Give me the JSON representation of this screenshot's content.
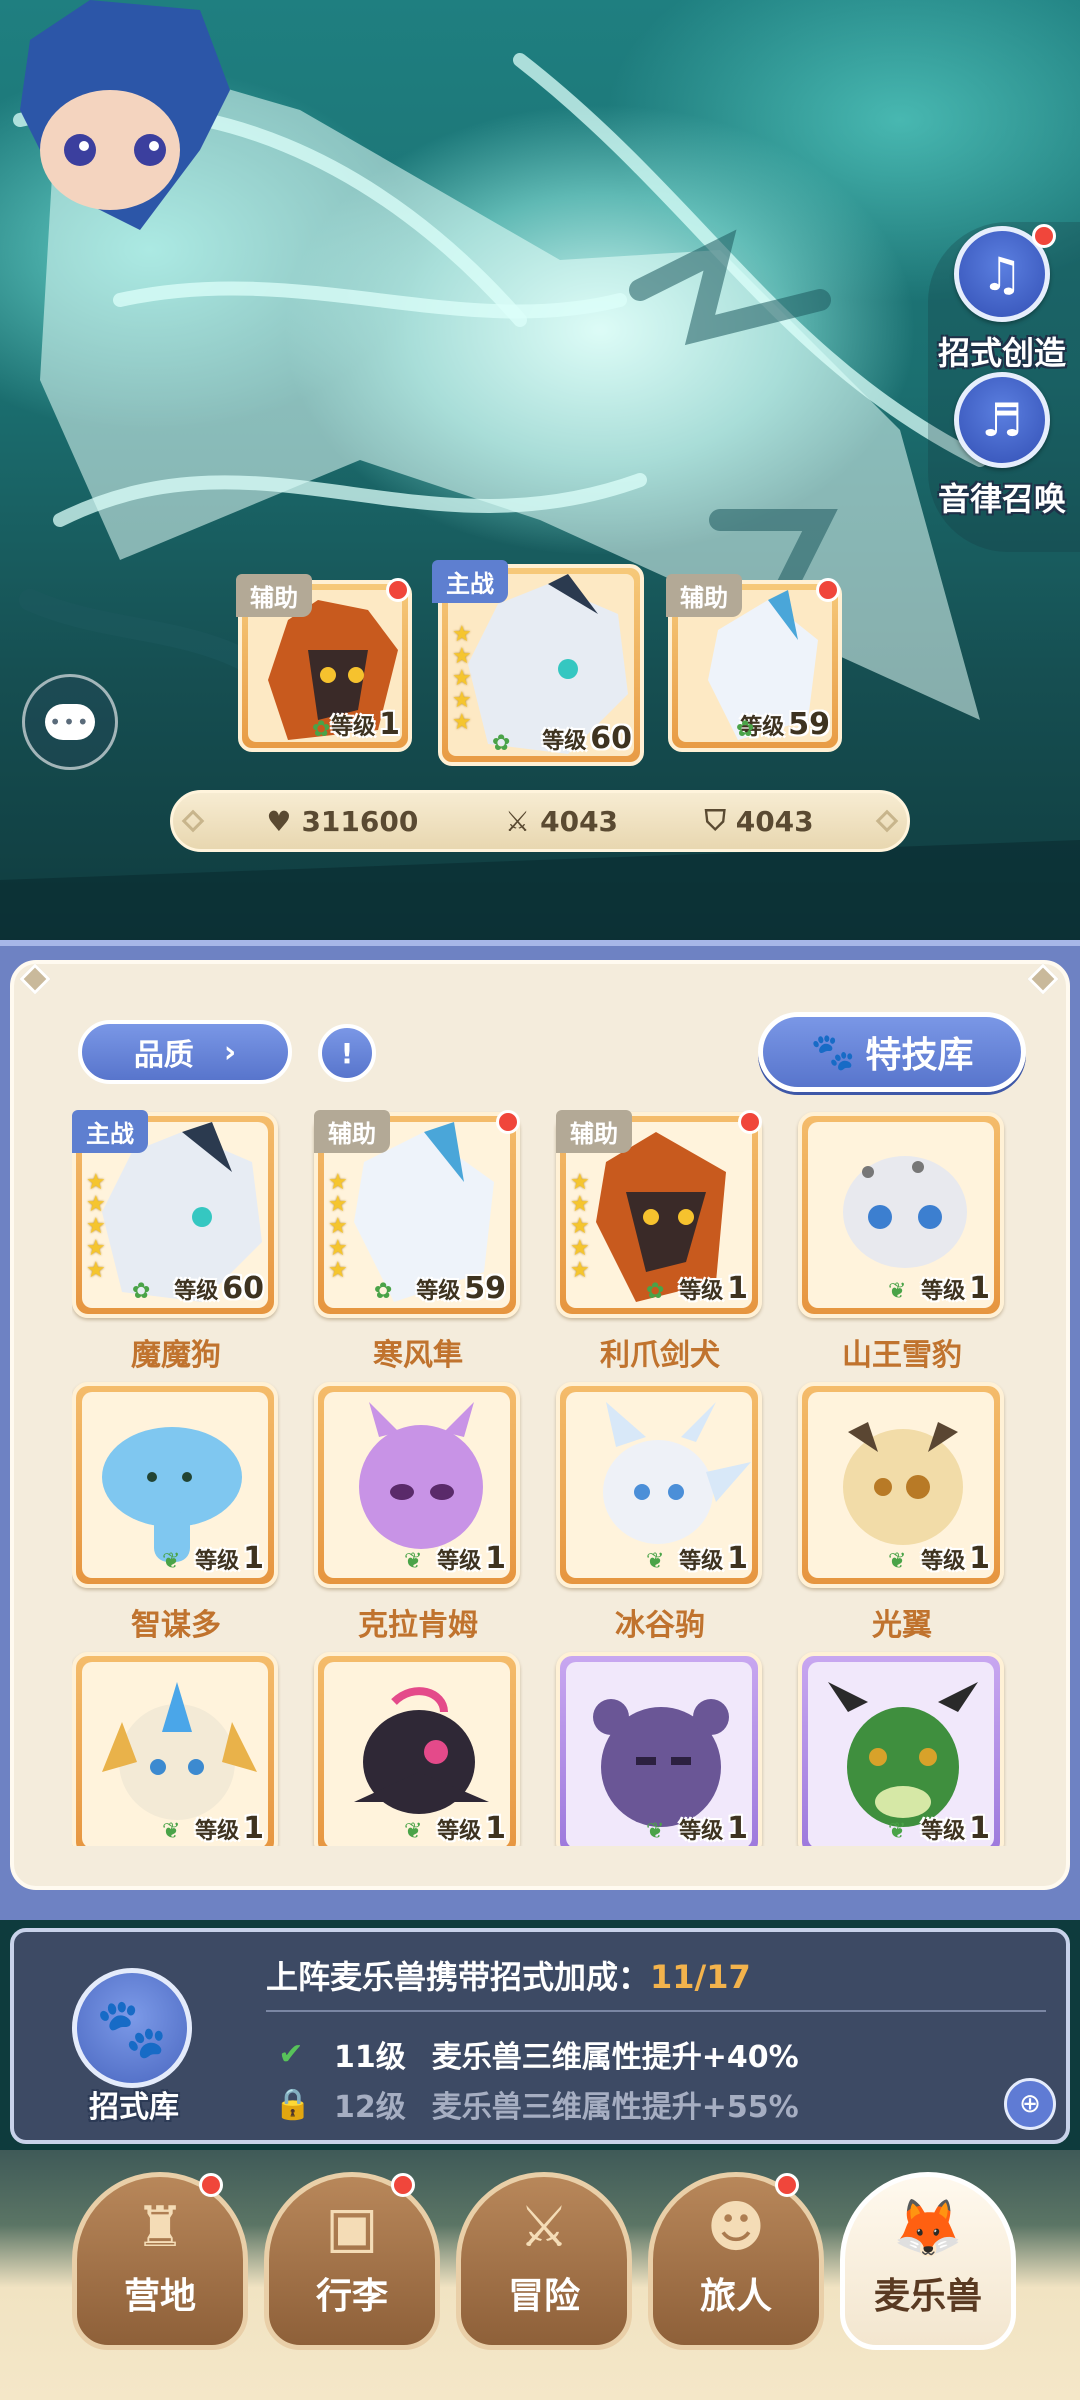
{
  "side_buttons": [
    {
      "label": "招式创造",
      "icon": "music-book-icon",
      "has_dot": true
    },
    {
      "label": "音律召唤",
      "icon": "lyre-icon",
      "has_dot": false
    }
  ],
  "team": [
    {
      "role": "辅助",
      "level_label": "等级",
      "level": "1",
      "has_dot": true
    },
    {
      "role": "主战",
      "level_label": "等级",
      "level": "60",
      "has_dot": false
    },
    {
      "role": "辅助",
      "level_label": "等级",
      "level": "59",
      "has_dot": true
    }
  ],
  "stats": {
    "hp": "311600",
    "attack": "4043",
    "defense": "4043"
  },
  "filters": {
    "quality_label": "品质",
    "book_label": "!",
    "skill_library_label": "特技库"
  },
  "pets": [
    {
      "name": "魔魔狗",
      "role": "主战",
      "level_label": "等级",
      "level": "60",
      "color": "orange",
      "stars": 5
    },
    {
      "name": "寒风隼",
      "role": "辅助",
      "level_label": "等级",
      "level": "59",
      "color": "orange",
      "stars": 5
    },
    {
      "name": "利爪剑犬",
      "role": "辅助",
      "level_label": "等级",
      "level": "1",
      "color": "orange",
      "stars": 5
    },
    {
      "name": "山王雪豹",
      "role": "",
      "level_label": "等级",
      "level": "1",
      "color": "orange",
      "stars": 0
    },
    {
      "name": "智谋多",
      "role": "",
      "level_label": "等级",
      "level": "1",
      "color": "orange",
      "stars": 0
    },
    {
      "name": "克拉肯姆",
      "role": "",
      "level_label": "等级",
      "level": "1",
      "color": "orange",
      "stars": 0
    },
    {
      "name": "冰谷驹",
      "role": "",
      "level_label": "等级",
      "level": "1",
      "color": "orange",
      "stars": 0
    },
    {
      "name": "光翼",
      "role": "",
      "level_label": "等级",
      "level": "1",
      "color": "orange",
      "stars": 0
    },
    {
      "name": "",
      "role": "",
      "level_label": "等级",
      "level": "1",
      "color": "orange",
      "stars": 0
    },
    {
      "name": "",
      "role": "",
      "level_label": "等级",
      "level": "1",
      "color": "orange",
      "stars": 0
    },
    {
      "name": "",
      "role": "",
      "level_label": "等级",
      "level": "1",
      "color": "purple",
      "stars": 0
    },
    {
      "name": "",
      "role": "",
      "level_label": "等级",
      "level": "1",
      "color": "purple",
      "stars": 0
    }
  ],
  "bonus": {
    "library_label": "招式库",
    "title": "上阵麦乐兽携带招式加成：",
    "count": "11/17",
    "rows": [
      {
        "level": "11级",
        "text": "麦乐兽三维属性提升+40%",
        "status": "achieved"
      },
      {
        "level": "12级",
        "text": "麦乐兽三维属性提升+55%",
        "status": "locked"
      }
    ]
  },
  "nav": [
    {
      "label": "营地",
      "icon": "castle-icon",
      "has_dot": true,
      "active": false
    },
    {
      "label": "行李",
      "icon": "chest-icon",
      "has_dot": true,
      "active": false
    },
    {
      "label": "冒险",
      "icon": "crossed-swords-icon",
      "has_dot": false,
      "active": false
    },
    {
      "label": "旅人",
      "icon": "traveler-icon",
      "has_dot": true,
      "active": false
    },
    {
      "label": "麦乐兽",
      "icon": "fox-icon",
      "has_dot": false,
      "active": true
    }
  ]
}
